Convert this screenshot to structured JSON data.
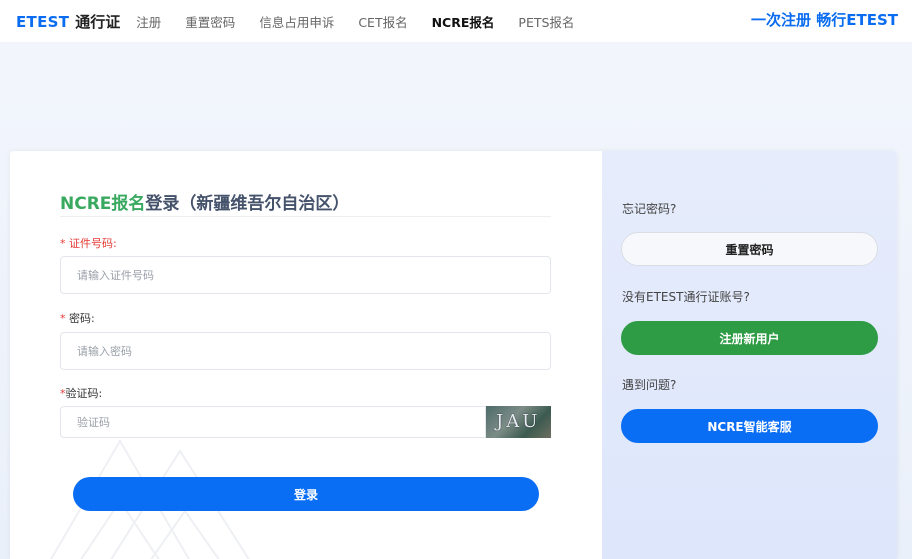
{
  "header": {
    "brand_etest": "ETEST",
    "brand_pass": "通行证",
    "nav": [
      "注册",
      "重置密码",
      "信息占用申诉",
      "CET报名",
      "NCRE报名",
      "PETS报名"
    ],
    "active_nav": "NCRE报名",
    "slogan": "一次注册 畅行ETEST"
  },
  "login": {
    "title_highlight": "NCRE报名",
    "title_rest": "登录（新疆维吾尔自治区）",
    "id_label": "证件号码:",
    "id_placeholder": "请输入证件号码",
    "password_label": "密码:",
    "password_placeholder": "请输入密码",
    "captcha_label": "验证码:",
    "captcha_placeholder": "验证码",
    "captcha_text": "JAU",
    "login_button": "登录",
    "required_mark": "*"
  },
  "side": {
    "forgot_label": "忘记密码?",
    "reset_button": "重置密码",
    "no_account_label": "没有ETEST通行证账号?",
    "register_button": "注册新用户",
    "problem_label": "遇到问题?",
    "service_button": "NCRE智能客服"
  },
  "colors": {
    "brand_blue": "#0a6cf0",
    "title_green": "#39a95f",
    "register_green": "#2e9b45",
    "required_red": "#e53935"
  }
}
